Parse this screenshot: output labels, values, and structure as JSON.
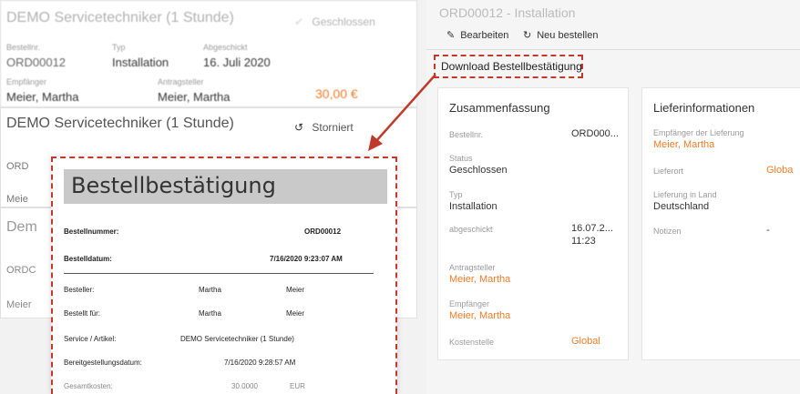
{
  "order_list": {
    "card1": {
      "title": "DEMO Servicetechniker (1 Stunde)",
      "status": "Geschlossen",
      "order_no_label": "Bestellnr.",
      "order_no": "ORD00012",
      "type_label": "Typ",
      "type": "Installation",
      "sent_label": "Abgeschickt",
      "sent": "16. Juli 2020",
      "recipient_label": "Empfänger",
      "recipient": "Meier, Martha",
      "requester_label": "Antragsteller",
      "requester": "Meier, Martha",
      "price": "30,00 €"
    },
    "card2": {
      "title": "DEMO Servicetechniker (1 Stunde)",
      "status": "Storniert",
      "frag1": "ORD",
      "frag2": "Meie"
    },
    "card3": {
      "title_frag": "Dem",
      "frag1": "ORDC",
      "frag2": "Meier"
    }
  },
  "right_panel": {
    "order_title": "ORD00012 - Installation",
    "toolbar": {
      "edit_label": "Bearbeiten",
      "reorder_label": "Neu bestellen"
    },
    "download_label": "Download Bestellbestätigung",
    "summary": {
      "title": "Zusammenfassung",
      "order_no_label": "Bestellnr.",
      "order_no": "ORD000...",
      "status_label": "Status",
      "status": "Geschlossen",
      "type_label": "Typ",
      "type": "Installation",
      "sent_label": "abgeschickt",
      "sent_date": "16.07.2...",
      "sent_time": "11:23",
      "requester_label": "Antragsteller",
      "requester": "Meier, Martha",
      "recipient_label": "Empfänger",
      "recipient": "Meier, Martha",
      "cost_center_label": "Kostenstelle",
      "cost_center": "Global"
    },
    "delivery": {
      "title": "Lieferinformationen",
      "recipient_label": "Empfänger der Lieferung",
      "recipient": "Meier, Martha",
      "location_label": "Lieferort",
      "location": "Globa",
      "country_label": "Lieferung in Land",
      "country": "Deutschland",
      "notes_label": "Notizen",
      "notes": "-"
    }
  },
  "confirmation_doc": {
    "heading": "Bestellbestätigung",
    "rows": [
      {
        "label": "Bestellnummer:",
        "value": "ORD00012"
      },
      {
        "label": "Bestelldatum:",
        "value": "7/16/2020 9:23:07 AM"
      }
    ],
    "details": [
      {
        "label": "Besteller:",
        "first": "Martha",
        "last": "Meier"
      },
      {
        "label": "Bestellt für:",
        "first": "Martha",
        "last": "Meier"
      }
    ],
    "service_label": "Service / Artikel:",
    "service_value": "DEMO Servicetechniker (1 Stunde)",
    "provision_label": "Bereitgestellungsdatum:",
    "provision_value": "7/16/2020 9:28:57 AM",
    "total_label": "Gesamtkosten:",
    "total_value": "30.0000",
    "total_currency": "EUR"
  },
  "colors": {
    "accent_orange": "#f07c2a",
    "annotation_red": "#c0392b"
  }
}
